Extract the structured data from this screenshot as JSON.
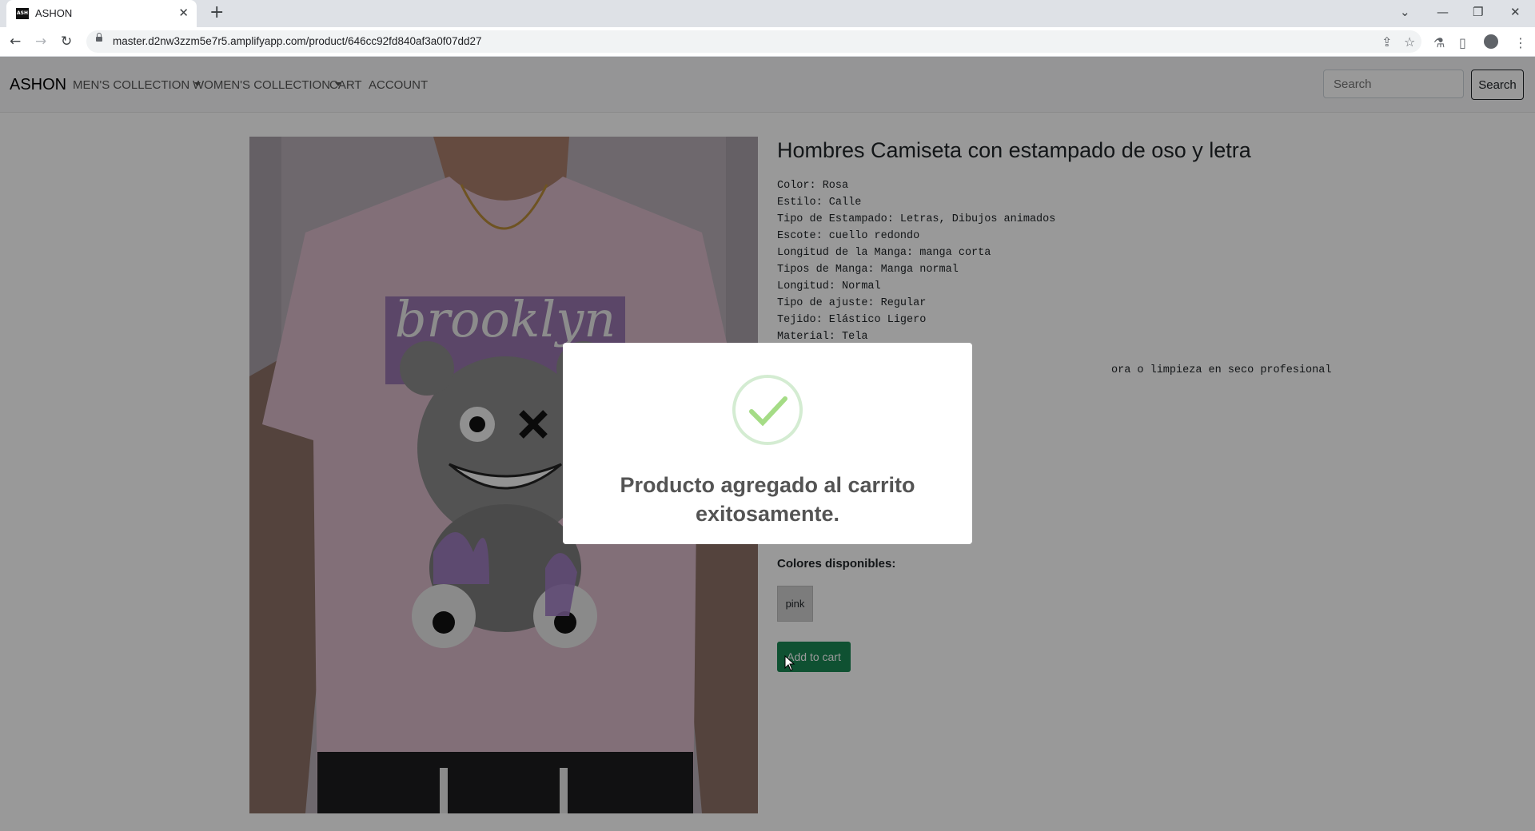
{
  "browser": {
    "tab_title": "ASHON",
    "favicon_text": "ASH",
    "new_tab": "+",
    "url": "master.d2nw3zzm5e7r5.amplifyapp.com/product/646cc92fd840af3a0f07dd27"
  },
  "navbar": {
    "brand": "ASHON",
    "links": [
      "MEN'S COLLECTION",
      "WOMEN'S COLLECTION",
      "CART",
      "ACCOUNT"
    ],
    "search_placeholder": "Search",
    "search_button": "Search"
  },
  "product": {
    "title": "Hombres Camiseta con estampado de oso y letra",
    "specs": [
      "Color: Rosa",
      "Estilo: Calle",
      "Tipo de Estampado: Letras, Dibujos animados",
      "Escote: cuello redondo",
      "Longitud de la Manga: manga corta",
      "Tipos de Manga: Manga normal",
      "Longitud: Normal",
      "Tipo de ajuste: Regular",
      "Tejido: Elástico Ligero",
      "Material: Tela",
      "",
      "ora o limpieza en seco profesional"
    ],
    "image_text": "brooklyn",
    "colors_heading": "Colores disponibles:",
    "colors": [
      "pink"
    ],
    "add_to_cart": "Add to cart"
  },
  "modal": {
    "message": "Producto agregado al carrito exitosamente."
  },
  "colors": {
    "modal_overlay": "rgba(0,0,0,0.4)",
    "add_to_cart_bg": "#198754",
    "success_check": "#a5dc86",
    "shirt": "#d9b9c9"
  }
}
